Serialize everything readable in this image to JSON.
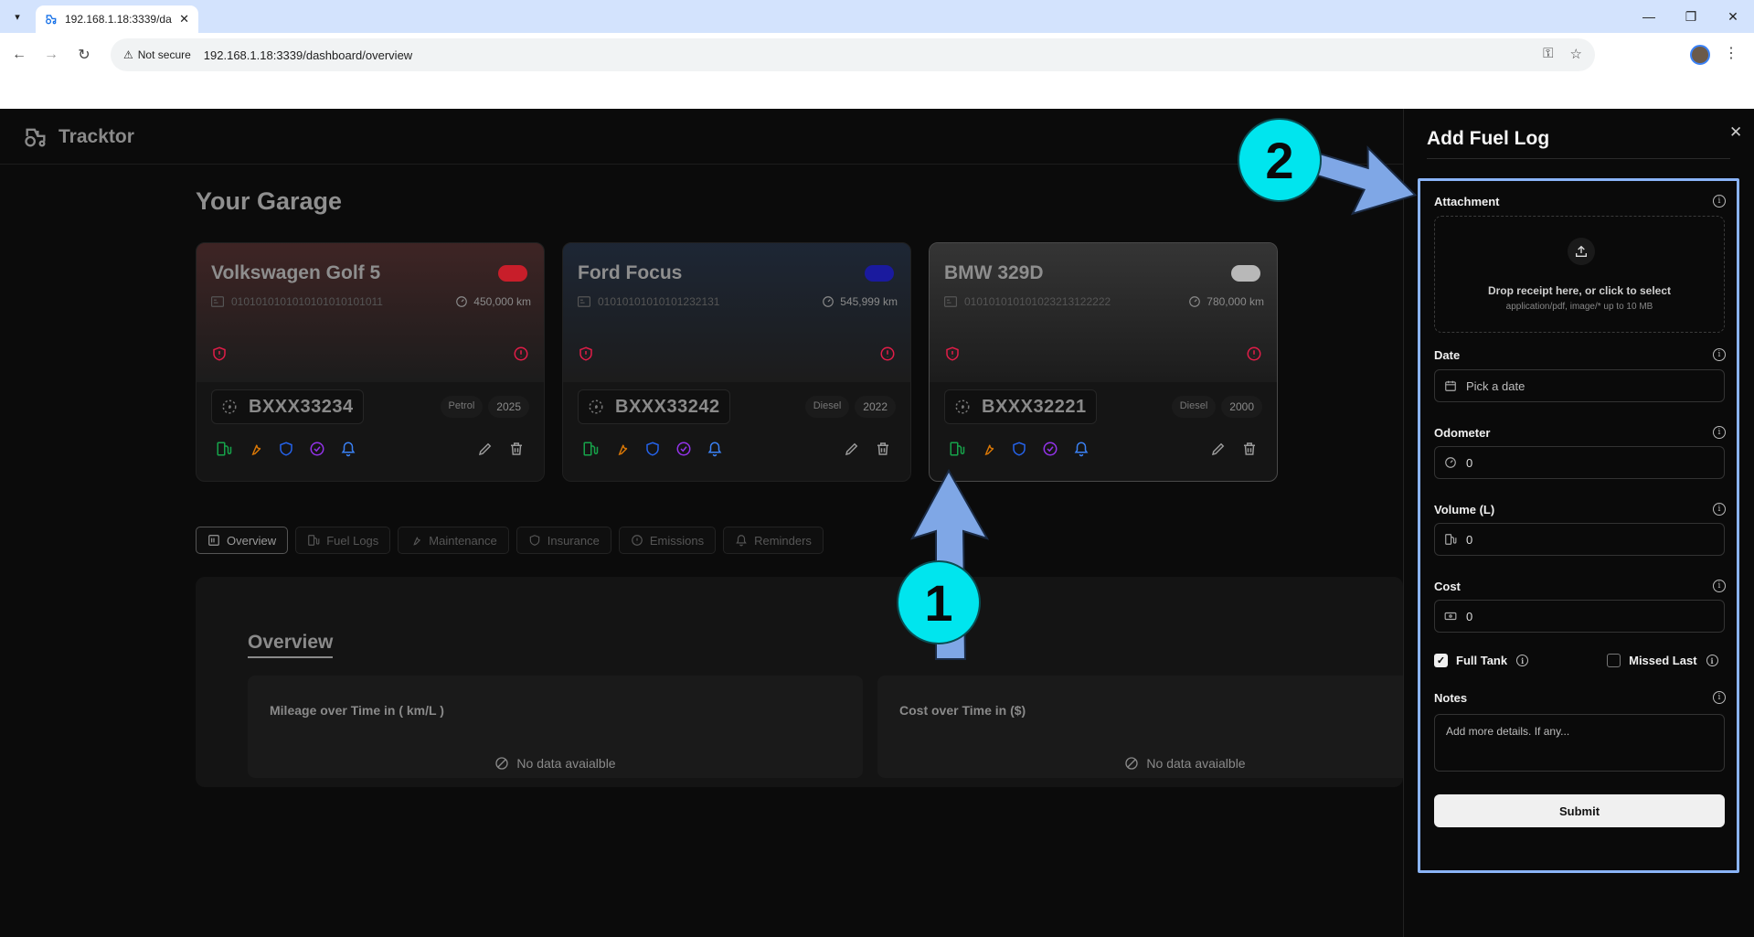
{
  "browser": {
    "tab_title": "192.168.1.18:3339/da",
    "not_secure": "Not secure",
    "url": "192.168.1.18:3339/dashboard/overview"
  },
  "app": {
    "brand": "Tracktor",
    "page_title": "Your Garage",
    "vehicles": [
      {
        "name": "Volkswagen Golf 5",
        "color": "#c81e2a",
        "vin": "0101010101010101010101011",
        "odometer": "450,000 km",
        "plate": "BXXX33234",
        "fuel": "Petrol",
        "year": "2025",
        "image_tint": "#5a2f2f"
      },
      {
        "name": "Ford Focus",
        "color": "#1a1a9e",
        "vin": "01010101010101232131",
        "odometer": "545,999 km",
        "plate": "BXXX33242",
        "fuel": "Diesel",
        "year": "2022",
        "image_tint": "#23324a"
      },
      {
        "name": "BMW 329D",
        "color": "#b8b8b8",
        "vin": "010101010101023213122222",
        "odometer": "780,000 km",
        "plate": "BXXX32221",
        "fuel": "Diesel",
        "year": "2000",
        "image_tint": "#4a4a4a"
      }
    ],
    "tabs": [
      "Overview",
      "Fuel Logs",
      "Maintenance",
      "Insurance",
      "Emissions",
      "Reminders"
    ],
    "active_tab": "Overview",
    "overview": {
      "title": "Overview",
      "mileage_title": "Mileage over Time in ( km/L )",
      "cost_title": "Cost over Time in ($)",
      "empty": "No data avaialble"
    }
  },
  "drawer": {
    "title": "Add Fuel Log",
    "close": "✕",
    "attachment_label": "Attachment",
    "dropzone_main": "Drop receipt here, or click to select",
    "dropzone_sub": "application/pdf, image/* up to 10 MB",
    "date_label": "Date",
    "date_placeholder": "Pick a date",
    "odometer_label": "Odometer",
    "odometer_value": "0",
    "volume_label": "Volume (L)",
    "volume_value": "0",
    "cost_label": "Cost",
    "cost_value": "0",
    "full_tank_label": "Full Tank",
    "full_tank_checked": true,
    "missed_last_label": "Missed Last",
    "missed_last_checked": false,
    "notes_label": "Notes",
    "notes_placeholder": "Add more details. If any...",
    "submit_label": "Submit"
  },
  "annotations": {
    "step1": "1",
    "step2": "2"
  },
  "colors": {
    "fuel": "#16a34a",
    "maintenance": "#d97706",
    "insurance": "#2563eb",
    "emissions": "#9333ea",
    "reminders": "#3b82f6",
    "alert": "#e11d48",
    "marker": "#00e5ee",
    "arrow": "#7fa7e6"
  }
}
